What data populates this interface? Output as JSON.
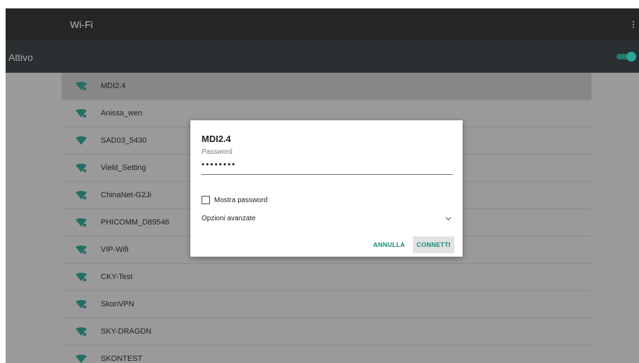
{
  "topbar": {
    "title": "Wi-Fi",
    "menu_icon": "more-vert-icon"
  },
  "master": {
    "label": "Attivo",
    "enabled": true,
    "accent": "#2ba697"
  },
  "networks": [
    {
      "name": "MDI2.4"
    },
    {
      "name": "Anissa_wen"
    },
    {
      "name": "SAD03_5430"
    },
    {
      "name": "Vield_Setting"
    },
    {
      "name": "ChinaNet-G2Ji"
    },
    {
      "name": "PHICOMM_D89546"
    },
    {
      "name": "VIP-Wifi"
    },
    {
      "name": "CKY-Test"
    },
    {
      "name": "SkonVPN"
    },
    {
      "name": "SKY-DRAGDN"
    },
    {
      "name": "SKONTEST"
    }
  ],
  "dialog": {
    "title": "MDI2.4",
    "password_label": "Password",
    "password_value": "••••••••",
    "show_password_label": "Mostra password",
    "advanced_label": "Opzioni avanzate",
    "cancel_label": "ANNULLA",
    "connect_label": "CONNETTI"
  },
  "colors": {
    "topbar": "#232526",
    "masterbar": "#2a3032",
    "list_bg": "#9a9a9a",
    "wifi_icon": "#236e65",
    "button_text": "#16887b"
  }
}
